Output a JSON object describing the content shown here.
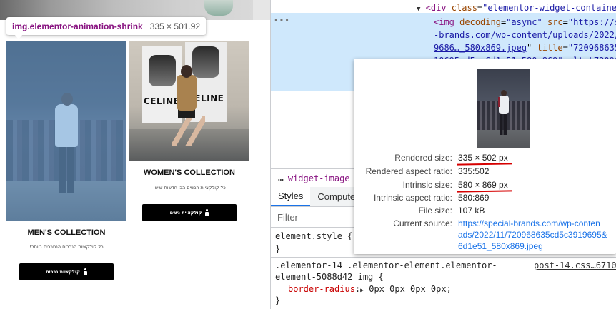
{
  "inspector": {
    "selector": "img.elementor-animation-shrink",
    "dimensions": "335 × 501.92"
  },
  "page": {
    "men": {
      "title": "MEN'S COLLECTION",
      "subtitle": "כל קולקציות הגברים הנמכרים ביותר!",
      "button": "קולקציית גברים"
    },
    "women": {
      "title": "WOMEN'S COLLECTION",
      "subtitle": "כל קולקציות הנשים הכי חדשות שיש!",
      "button": "קולקציית נשים"
    },
    "poster_text": "CELINE"
  },
  "dom": {
    "line1_tag_open": "<div",
    "line1_attr": "class",
    "line1_val": "\"elementor-widget-containe",
    "line2_tag": "<img",
    "line2_attr1": "decoding",
    "line2_val1": "\"async\"",
    "line2_attr2": "src",
    "line2_val2": "\"https://s",
    "line3_link": "-brands.com/wp-content/uploads/2022/",
    "line4_link": "9686…_580x869.jpeg",
    "line4_attr": "title",
    "line4_val": "\"720968635",
    "line5_partial": "10695cd5c…6d1e51_580x869\" alt=\"720968"
  },
  "breadcrumb": {
    "dots": "…",
    "crumb": "widget-image"
  },
  "tabs": [
    {
      "label": "Styles"
    },
    {
      "label": "Compute"
    }
  ],
  "filter": {
    "placeholder": "Filter"
  },
  "styles": {
    "element_style": "element.style {",
    "element_style_close": "}",
    "rule_selector_1": ".elementor-14 .elementor-element.elementor-",
    "rule_selector_2": "element-5088d42 img {",
    "rule_source": "post-14.css…6710",
    "prop_name": "border-radius",
    "prop_value": "0px 0px 0px 0px;",
    "rule_close": "}"
  },
  "popover": {
    "rows": [
      {
        "label": "Rendered size:",
        "value": "335 × 502 px"
      },
      {
        "label": "Rendered aspect ratio:",
        "value": "335:502"
      },
      {
        "label": "Intrinsic size:",
        "value": "580 × 869 px"
      },
      {
        "label": "Intrinsic aspect ratio:",
        "value": "580:869"
      },
      {
        "label": "File size:",
        "value": "107 kB"
      },
      {
        "label": "Current source:",
        "value": "https://special-brands.com/wp-conten"
      }
    ],
    "source_line2": "ads/2022/11/720968635cd5c3919695&",
    "source_line3": "6d1e51_580x869.jpeg"
  },
  "colors": {
    "tag": "#881280",
    "attr": "#994500",
    "value": "#1a1aa6",
    "highlight": "#cfe8fc",
    "underline": "#d60000",
    "overlay": "#6fa8dc"
  }
}
